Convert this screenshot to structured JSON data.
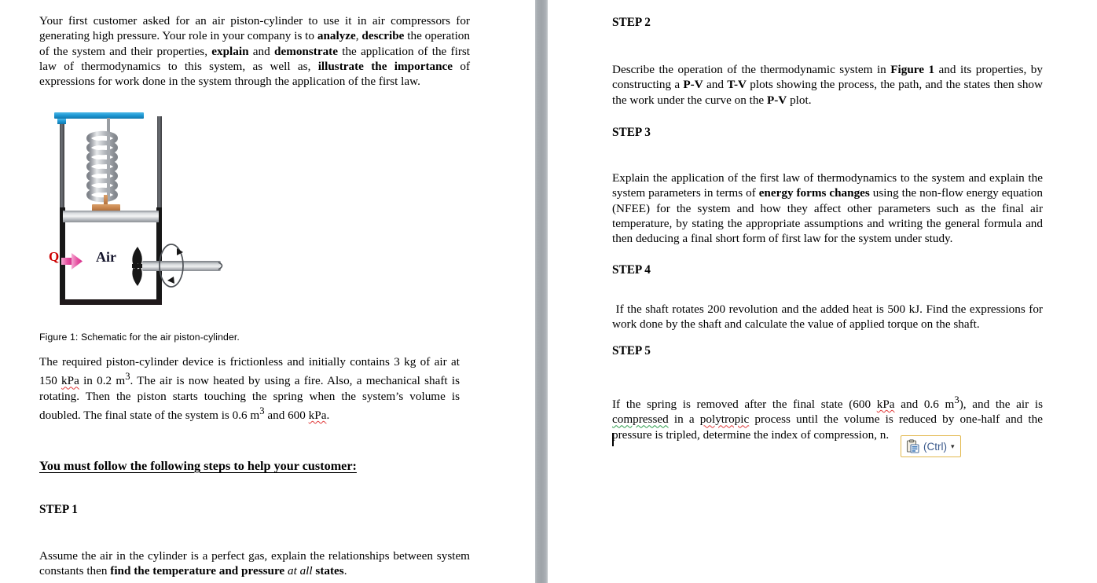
{
  "document": {
    "left_page": {
      "intro_paragraph_html": "Your first customer asked for an air piston-cylinder to use it in air compressors for generating high pressure. Your role in your company is to <b>analyze</b>, <b>describe</b> the operation of the system and their properties, <b>explain</b> and <b>demonstrate</b> the application of the first law of thermodynamics to this system, as well as, <b>illustrate the importance</b> of expressions for work done in the system through the application of the first law.",
      "figure_caption": "Figure 1: Schematic for the air piston-cylinder.",
      "device_paragraph_html": "The required piston-cylinder device is frictionless and initially contains 3 kg of air at 150 <span class=\"squig\">kPa</span> in 0.2 m<sup>3</sup>. The air is now heated by using a fire. Also, a mechanical shaft is rotating. Then the piston starts touching the spring when the system&rsquo;s volume is doubled. The final state of the system is 0.6 m<sup>3</sup> and 600 <span class=\"squig\">kPa</span>.",
      "follow_heading": "You must follow the following steps to help your customer:",
      "step1_heading": "STEP 1",
      "step1_body_html": "Assume the air in the cylinder is a perfect gas, explain the relationships between system constants then <b>find the temperature and pressure</b> <i>at all</i> <b>states</b>."
    },
    "right_page": {
      "step2_heading": "STEP 2",
      "step2_body_html": "Describe the operation of the thermodynamic system in <b>Figure 1</b> and its properties, by constructing a <b>P-V</b> and <b>T-V</b> plots showing the process, the path, and the states then show the work under the curve on the <b>P-V</b> plot.",
      "step3_heading": "STEP 3",
      "step3_body_html": "Explain the application of the first law of thermodynamics to the system and explain the system parameters in terms of <b>energy forms changes</b> using the non-flow energy equation (NFEE) for the system and how they affect other parameters such as the final air temperature, by stating the appropriate assumptions and writing the general formula and then deducing a final short form of first law for the system under study.",
      "step4_heading": "STEP 4",
      "step4_body_html": "&nbsp;If the shaft rotates 200 revolution and the added heat is 500 kJ. Find the expressions for work done by the shaft and calculate the value of applied torque on the shaft.",
      "step5_heading": "STEP 5",
      "step5_body_html": "If the spring is removed after the final state (600 <span class=\"squig\">kPa</span> and 0.6 m<sup>3</sup>), and the air is <span class=\"squig-green\">compressed</span> in a <span class=\"squig\">polytropic</span> process until the volume is reduced by one-half and the pressure is tripled, determine the index of compression, n."
    }
  },
  "figure": {
    "labels": {
      "heat_label": "Q",
      "gas_label": "Air"
    },
    "colors": {
      "top_bar": "#1f9ad6",
      "heat_arrow": "#e64fa0",
      "heat_label_color": "#cc0000",
      "spring_metal": "#b9bcc0",
      "piston_metal": "#c9ccd0",
      "spring_foot": "#c8864f",
      "cylinder_wall": "#1a1a1a",
      "paddle": "#1a1a1a"
    }
  },
  "paste_options": {
    "label": "(Ctrl)",
    "caret_glyph": "▾",
    "icon": "clipboard-paste-icon",
    "border_color": "#e2b84e",
    "label_color": "#3b5a8c"
  },
  "gutter": {
    "color": "#a6abb0"
  }
}
